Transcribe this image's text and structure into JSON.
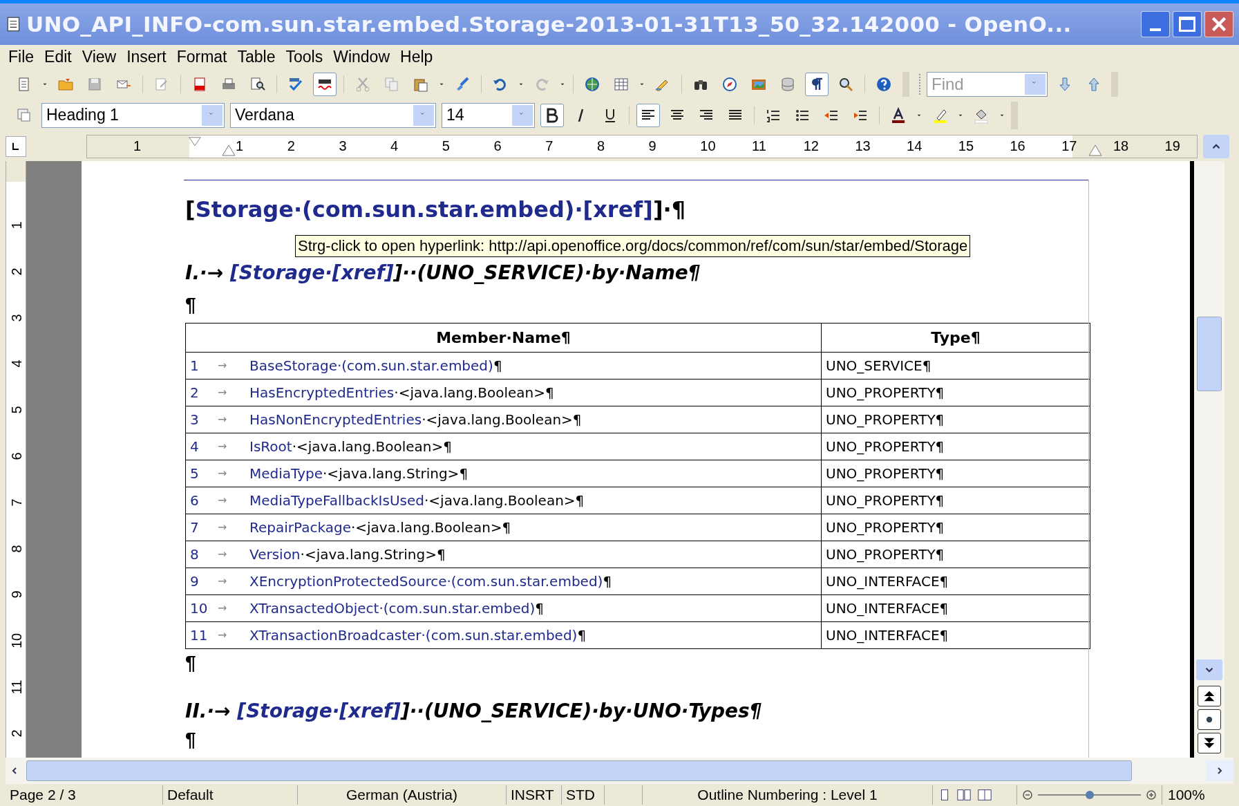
{
  "window": {
    "title": "UNO_API_INFO-com.sun.star.embed.Storage-2013-01-31T13_50_32.142000 -  OpenO..."
  },
  "menu": [
    "File",
    "Edit",
    "View",
    "Insert",
    "Format",
    "Table",
    "Tools",
    "Window",
    "Help"
  ],
  "toggles": {
    "autospell": true,
    "formatting_marks": true,
    "bold": true,
    "italic": false,
    "underline": false,
    "align_left": true
  },
  "paragraph_style": "Heading 1",
  "font_name": "Verdana",
  "font_size": "14",
  "find": {
    "placeholder": "Find"
  },
  "ruler": {
    "horizontal": [
      "1",
      "1",
      "2",
      "3",
      "4",
      "5",
      "6",
      "7",
      "8",
      "9",
      "10",
      "11",
      "12",
      "13",
      "14",
      "15",
      "16",
      "17",
      "18",
      "19"
    ],
    "vertical": [
      "1",
      "2",
      "3",
      "4",
      "5",
      "6",
      "7",
      "8",
      "9",
      "10",
      "11",
      "2"
    ]
  },
  "document": {
    "heading_1": {
      "before": "[",
      "link": "Storage·(com.sun.star.embed)·[xref]",
      "after": "]·¶"
    },
    "tooltip": "Strg-click to open hyperlink: http://api.openoffice.org/docs/common/ref/com/sun/star/embed/Storage",
    "heading_2a": {
      "before": "I.·→ ",
      "link": "[Storage·[xref]",
      "after": "]··(UNO_SERVICE)·by·Name¶"
    },
    "empty_paragraph_1": "¶",
    "table": {
      "columns": [
        "Member·Name¶",
        "Type¶"
      ],
      "rows": [
        {
          "number": "1",
          "arrow": "→",
          "name": "BaseStorage·(com.sun.star.embed)",
          "rest": "¶",
          "type": "UNO_SERVICE¶"
        },
        {
          "number": "2",
          "arrow": "→",
          "name": "HasEncryptedEntries",
          "rest": "·<java.lang.Boolean>¶",
          "type": "UNO_PROPERTY¶"
        },
        {
          "number": "3",
          "arrow": "→",
          "name": "HasNonEncryptedEntries",
          "rest": "·<java.lang.Boolean>¶",
          "type": "UNO_PROPERTY¶"
        },
        {
          "number": "4",
          "arrow": "→",
          "name": "IsRoot",
          "rest": "·<java.lang.Boolean>¶",
          "type": "UNO_PROPERTY¶"
        },
        {
          "number": "5",
          "arrow": "→",
          "name": "MediaType",
          "rest": "·<java.lang.String>¶",
          "type": "UNO_PROPERTY¶"
        },
        {
          "number": "6",
          "arrow": "→",
          "name": "MediaTypeFallbackIsUsed",
          "rest": "·<java.lang.Boolean>¶",
          "type": "UNO_PROPERTY¶"
        },
        {
          "number": "7",
          "arrow": "→",
          "name": "RepairPackage",
          "rest": "·<java.lang.Boolean>¶",
          "type": "UNO_PROPERTY¶"
        },
        {
          "number": "8",
          "arrow": "→",
          "name": "Version",
          "rest": "·<java.lang.String>¶",
          "type": "UNO_PROPERTY¶"
        },
        {
          "number": "9",
          "arrow": "→",
          "name": "XEncryptionProtectedSource·(com.sun.star.embed)",
          "rest": "¶",
          "type": "UNO_INTERFACE¶"
        },
        {
          "number": "10",
          "arrow": "→",
          "name": "XTransactedObject·(com.sun.star.embed)",
          "rest": "¶",
          "type": "UNO_INTERFACE¶"
        },
        {
          "number": "11",
          "arrow": "→",
          "name": "XTransactionBroadcaster·(com.sun.star.embed)",
          "rest": "¶",
          "type": "UNO_INTERFACE¶"
        }
      ]
    },
    "empty_paragraph_2": "¶",
    "heading_2b": {
      "before": "II.·→ ",
      "link": "[Storage·[xref]",
      "after": "]··(UNO_SERVICE)·by·UNO·Types¶"
    },
    "empty_paragraph_3": "¶"
  },
  "status_bar": {
    "page": "Page 2 / 3",
    "page_style": "Default",
    "language": "German (Austria)",
    "insert_mode": "INSRT",
    "selection_mode": "STD",
    "outline": "Outline Numbering : Level 1",
    "zoom": {
      "level": 0.5
    },
    "zoom_percent": "100%"
  }
}
